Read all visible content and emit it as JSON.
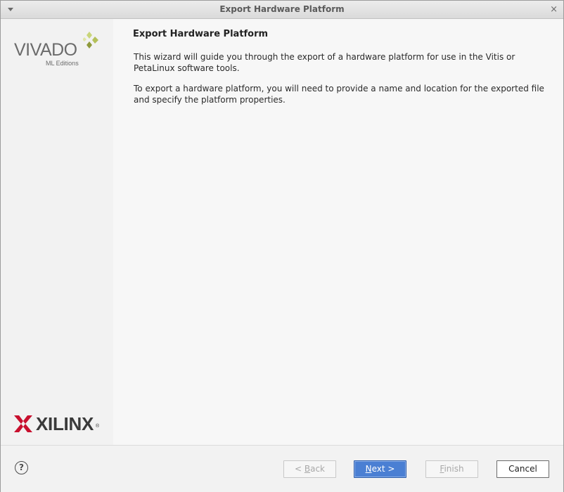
{
  "window": {
    "title": "Export Hardware Platform",
    "close_glyph": "×"
  },
  "branding": {
    "product": "VIVADO",
    "edition": "ML Editions",
    "company": "XILINX",
    "registered": "®"
  },
  "content": {
    "heading": "Export Hardware Platform",
    "paragraph1": "This wizard will guide you through the export of a hardware platform for use in the Vitis or PetaLinux software tools.",
    "paragraph2": "To export a hardware platform, you will need to provide a name and location for the exported file and specify the platform properties."
  },
  "footer": {
    "help_glyph": "?",
    "back": {
      "prefix": "< ",
      "mnemonic": "B",
      "rest": "ack",
      "enabled": false
    },
    "next": {
      "mnemonic": "N",
      "rest": "ext >",
      "enabled": true
    },
    "finish": {
      "mnemonic": "F",
      "rest": "inish",
      "enabled": false
    },
    "cancel": {
      "label": "Cancel",
      "enabled": true
    }
  },
  "colors": {
    "primary_button": "#4a7fd3",
    "vivado_mark_light": "#c9d57a",
    "vivado_mark_dark": "#8f9a3c",
    "xilinx_red": "#c8102e"
  }
}
